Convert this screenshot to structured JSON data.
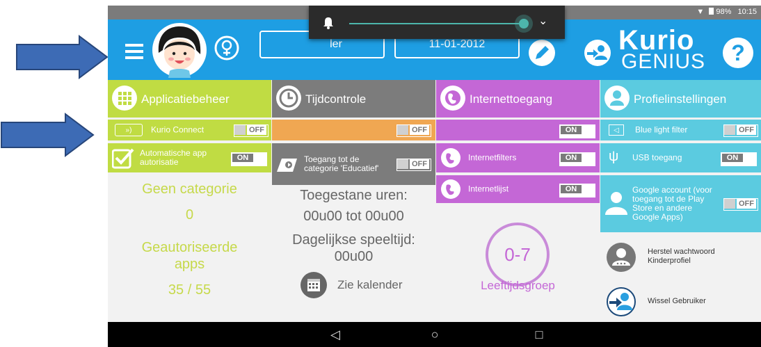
{
  "status_bar": {
    "battery": "98%",
    "time": "10:15"
  },
  "header": {
    "name_box": "ler",
    "date_box": "11-01-2012",
    "brand_top": "Kurio",
    "brand_bottom": "GENIUS",
    "help_label": "?"
  },
  "columns": {
    "apps": {
      "title": "Applicatiebeheer",
      "kurio_connect": {
        "label": "Kurio Connect",
        "toggle": "OFF"
      },
      "auto_auth": {
        "label": "Automatische app autorisatie",
        "toggle": "ON"
      },
      "category_label": "Geen categorie",
      "category_value": "0",
      "authorized_label": "Geautoriseerde apps",
      "authorized_value": "35 / 55"
    },
    "time": {
      "title": "Tijdcontrole",
      "toggle": "OFF",
      "educational": {
        "label": "Toegang tot de categorie 'Educatief'",
        "toggle": "OFF"
      },
      "allowed_label": "Toegestane uren:",
      "allowed_value": "00u00 tot 00u00",
      "daily_label": "Dagelijkse speeltijd:",
      "daily_value": "00u00",
      "calendar_label": "Zie kalender"
    },
    "internet": {
      "title": "Internettoegang",
      "toggle": "ON",
      "filters": {
        "label": "Internetfilters",
        "toggle": "ON"
      },
      "list": {
        "label": "Internetlijst",
        "toggle": "ON"
      },
      "age_group_value": "0-7",
      "age_group_label": "Leeftijdsgroep"
    },
    "profile": {
      "title": "Profielinstellingen",
      "blue_light": {
        "label": "Blue light filter",
        "toggle": "OFF"
      },
      "usb": {
        "label": "USB toegang",
        "toggle": "ON"
      },
      "google": {
        "label": "Google account (voor toegang tot de Play Store en andere Google Apps)",
        "toggle": "OFF"
      },
      "reset_password": "Herstel wachtwoord Kinderprofiel",
      "switch_user": "Wissel Gebruiker"
    }
  },
  "colors": {
    "header_blue": "#1e9ee3",
    "apps_green": "#c0dc43",
    "apps_text": "#c6d94a",
    "time_orange": "#f0a752",
    "time_gray": "#7c7c7c",
    "internet_purple": "#c467d6",
    "profile_cyan": "#5bcbe0",
    "arrow_blue": "#3d6bb5"
  }
}
